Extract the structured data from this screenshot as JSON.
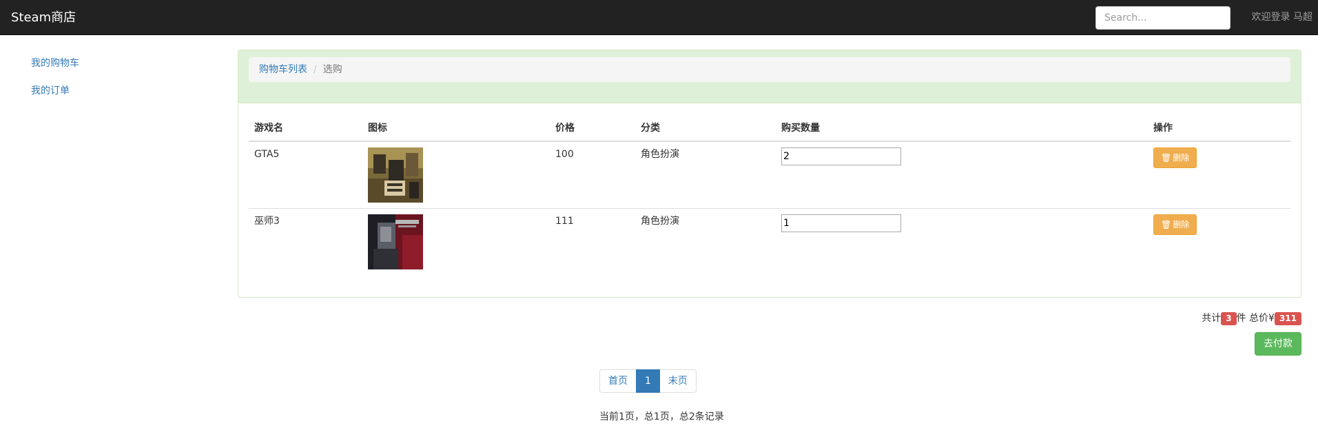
{
  "navbar": {
    "brand": "Steam商店",
    "search_placeholder": "Search...",
    "welcome": "欢迎登录 马超"
  },
  "sidebar": {
    "items": [
      {
        "label": "我的购物车"
      },
      {
        "label": "我的订单"
      }
    ]
  },
  "breadcrumb": {
    "items": [
      "购物车列表",
      "选购"
    ],
    "separator": "/"
  },
  "table": {
    "headers": [
      "游戏名",
      "图标",
      "价格",
      "分类",
      "购买数量",
      "操作"
    ],
    "rows": [
      {
        "name": "GTA5",
        "icon": "gta5-cover-image",
        "price": "100",
        "category": "角色扮演",
        "quantity": "2",
        "action": "删除"
      },
      {
        "name": "巫师3",
        "icon": "witcher3-cover-image",
        "price": "111",
        "category": "角色扮演",
        "quantity": "1",
        "action": "删除"
      }
    ]
  },
  "summary": {
    "prefix": "共计",
    "count": "3",
    "middle": "件 总价¥",
    "total": "311",
    "pay_label": "去付款"
  },
  "pagination": {
    "first": "首页",
    "current": "1",
    "last": "末页",
    "info": "当前1页，总1页，总2条记录"
  },
  "colors": {
    "navbar_bg": "#222222",
    "panel_heading_bg": "#dff0d8",
    "link": "#337ab7",
    "delete_button": "#f0ad4e",
    "badge": "#d9534f",
    "pay_button": "#5cb85c"
  }
}
